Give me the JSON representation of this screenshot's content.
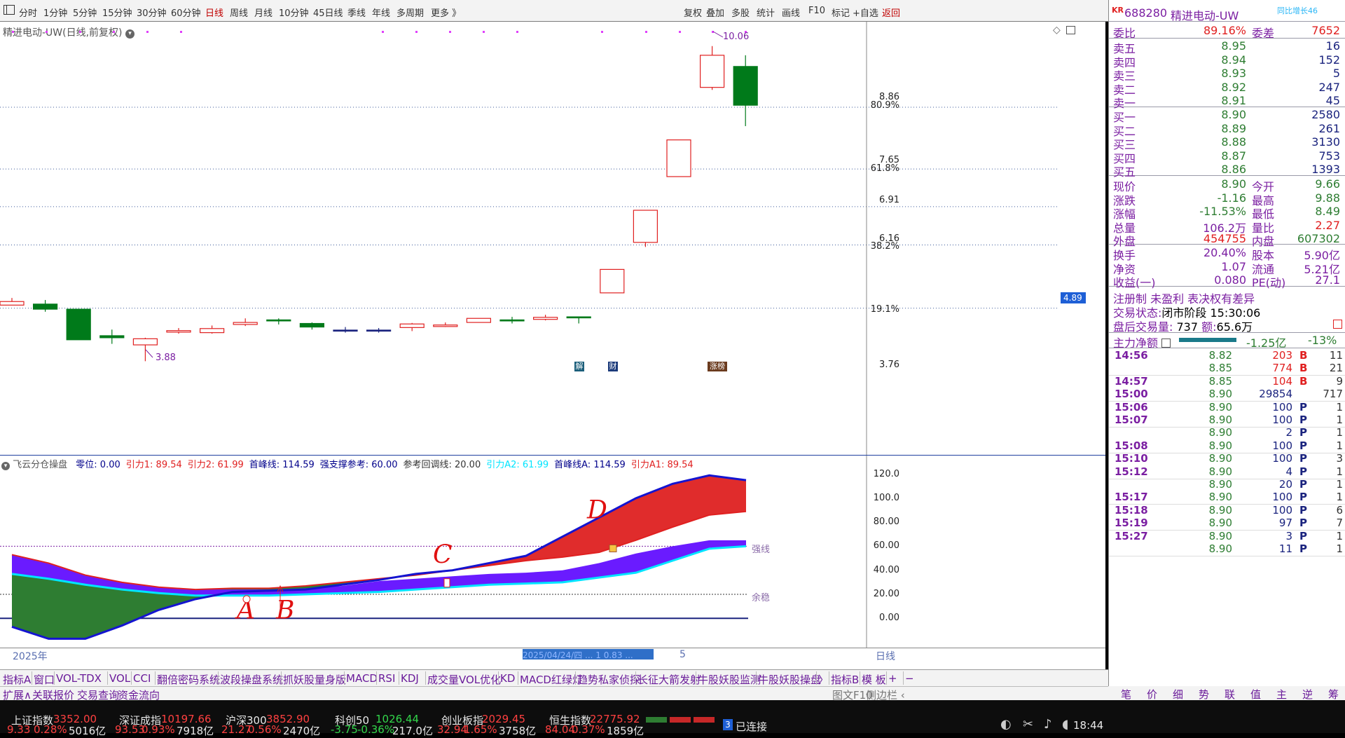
{
  "toolbar": {
    "left_items": [
      "分时",
      "1分钟",
      "5分钟",
      "15分钟",
      "30分钟",
      "60分钟",
      "日线",
      "周线",
      "月线",
      "10分钟",
      "45日线",
      "季线",
      "年线",
      "多周期",
      "更多 》"
    ],
    "active": "日线",
    "right_items": [
      "复权",
      "叠加",
      "多股",
      "统计",
      "画线",
      "F10",
      "标记",
      "+自选",
      "返回"
    ]
  },
  "chart": {
    "title": "精进电动-UW(日线,前复权)",
    "high_label": "10.06",
    "low_label": "3.88",
    "price_ticks": [
      "8.86",
      "7.65",
      "6.91",
      "6.16",
      "3.76"
    ],
    "pct_ticks": [
      "80.9%",
      "61.8%",
      "38.2%",
      "19.1%"
    ],
    "current_marker": "4.89",
    "event_markers": [
      "解",
      "财",
      "涨榜"
    ],
    "candles": [
      {
        "o": 5.05,
        "c": 4.98,
        "h": 5.12,
        "l": 4.98,
        "dir": "up"
      },
      {
        "o": 5.0,
        "c": 4.9,
        "h": 5.08,
        "l": 4.85,
        "dir": "down"
      },
      {
        "o": 4.9,
        "c": 4.3,
        "h": 4.9,
        "l": 4.3,
        "dir": "down"
      },
      {
        "o": 4.38,
        "c": 4.34,
        "h": 4.5,
        "l": 4.22,
        "dir": "down"
      },
      {
        "o": 4.2,
        "c": 4.32,
        "h": 4.34,
        "l": 3.88,
        "dir": "up"
      },
      {
        "o": 4.45,
        "c": 4.48,
        "h": 4.53,
        "l": 4.42,
        "dir": "up"
      },
      {
        "o": 4.44,
        "c": 4.52,
        "h": 4.58,
        "l": 4.42,
        "dir": "up"
      },
      {
        "o": 4.6,
        "c": 4.64,
        "h": 4.72,
        "l": 4.57,
        "dir": "up"
      },
      {
        "o": 4.69,
        "c": 4.67,
        "h": 4.72,
        "l": 4.6,
        "dir": "down"
      },
      {
        "o": 4.62,
        "c": 4.55,
        "h": 4.64,
        "l": 4.5,
        "dir": "down"
      },
      {
        "o": 4.49,
        "c": 4.49,
        "h": 4.55,
        "l": 4.44,
        "dir": "flat"
      },
      {
        "o": 4.49,
        "c": 4.49,
        "h": 4.53,
        "l": 4.44,
        "dir": "flat"
      },
      {
        "o": 4.54,
        "c": 4.61,
        "h": 4.63,
        "l": 4.47,
        "dir": "up"
      },
      {
        "o": 4.56,
        "c": 4.59,
        "h": 4.64,
        "l": 4.55,
        "dir": "up"
      },
      {
        "o": 4.64,
        "c": 4.72,
        "h": 4.72,
        "l": 4.64,
        "dir": "up"
      },
      {
        "o": 4.69,
        "c": 4.67,
        "h": 4.75,
        "l": 4.62,
        "dir": "down"
      },
      {
        "o": 4.7,
        "c": 4.74,
        "h": 4.79,
        "l": 4.68,
        "dir": "up"
      },
      {
        "o": 4.75,
        "c": 4.73,
        "h": 4.75,
        "l": 4.62,
        "dir": "down"
      },
      {
        "o": 5.22,
        "c": 5.68,
        "h": 5.68,
        "l": 5.22,
        "dir": "up"
      },
      {
        "o": 6.21,
        "c": 6.84,
        "h": 6.84,
        "l": 6.12,
        "dir": "up"
      },
      {
        "o": 7.5,
        "c": 8.22,
        "h": 8.22,
        "l": 7.5,
        "dir": "up"
      },
      {
        "o": 9.25,
        "c": 9.88,
        "h": 10.06,
        "l": 9.2,
        "dir": "up"
      },
      {
        "o": 9.66,
        "c": 8.9,
        "h": 9.88,
        "l": 8.49,
        "dir": "down"
      }
    ]
  },
  "indicator": {
    "name": "飞云分仓操盘",
    "params": [
      {
        "t": "零位: 0.00",
        "c": "#00008b"
      },
      {
        "t": "引力1: 89.54",
        "c": "#e02020"
      },
      {
        "t": "引力2: 61.99",
        "c": "#e02020"
      },
      {
        "t": "首峰线: 114.59",
        "c": "#00008b"
      },
      {
        "t": "强支撑参考: 60.00",
        "c": "#00008b"
      },
      {
        "t": "参考回调线: 20.00",
        "c": "#333333"
      },
      {
        "t": "引力A2: 61.99",
        "c": "#00e5ff"
      },
      {
        "t": "首峰线A: 114.59",
        "c": "#00008b"
      },
      {
        "t": "引力A1: 89.54",
        "c": "#e02020"
      }
    ],
    "y_ticks": [
      "120.0",
      "100.0",
      "80.00",
      "60.00",
      "40.00",
      "20.00",
      "0.00"
    ],
    "ref_labels": [
      "强线",
      "余稳"
    ],
    "annotations": [
      "A",
      "B",
      "C",
      "D"
    ],
    "blue_line": [
      -7,
      -17,
      -17,
      -6,
      7,
      16,
      22,
      23,
      24,
      28,
      32,
      37,
      40,
      46,
      52,
      68,
      84,
      100,
      112,
      119,
      115
    ],
    "red_line": [
      53,
      46,
      36,
      30,
      26,
      24,
      25,
      25,
      27,
      30,
      33,
      36,
      40,
      44,
      48,
      51,
      55,
      65,
      76,
      86,
      89
    ],
    "purple_line": [
      53,
      46,
      36,
      30,
      26,
      24,
      24,
      24,
      25,
      27,
      31,
      33,
      35,
      37,
      38,
      40,
      46,
      54,
      60,
      65,
      65
    ],
    "cyan_line": [
      37,
      33,
      28,
      24,
      21,
      19,
      19,
      19,
      20,
      21,
      22,
      24,
      26,
      28,
      29,
      30,
      34,
      38,
      48,
      58,
      60
    ]
  },
  "date_bar": {
    "year": "2025年",
    "highlight": "2025/04/24/四 ... 1 0.83 ...",
    "day": "5",
    "period": "日线"
  },
  "tabs_row1": [
    "指标A",
    "窗口",
    "VOL-TDX",
    "VOL",
    "CCI",
    "翻倍密码系统",
    "波段操盘系统",
    "抓妖股量身版",
    "MACD",
    "RSI",
    "KDJ",
    "成交量VOL优化",
    "KD",
    "MACD红绿灯",
    "趋势私家侦探",
    "长征大箭发射",
    "牛股妖股监测",
    "牛股妖股操盘",
    "〉",
    "指标B",
    "模 板",
    "+",
    "−"
  ],
  "tabs_row2": [
    "扩展∧",
    "关联报价",
    "交易查询",
    "资金流向"
  ],
  "tabs_row2_right": [
    "图文F10",
    "侧边栏 ‹"
  ],
  "right_tabs": [
    "笔",
    "价",
    "细",
    "势",
    "联",
    "值",
    "主",
    "逆",
    "筹"
  ],
  "quote": {
    "market_tag": "KR",
    "code": "688280",
    "name": "精进电动-UW",
    "note": "同比增长46",
    "weibi_label": "委比",
    "weibi": "89.16%",
    "weicha_label": "委差",
    "weicha": "7652",
    "asks": [
      {
        "l": "卖五",
        "p": "8.95",
        "v": "16"
      },
      {
        "l": "卖四",
        "p": "8.94",
        "v": "152"
      },
      {
        "l": "卖三",
        "p": "8.93",
        "v": "5"
      },
      {
        "l": "卖二",
        "p": "8.92",
        "v": "247"
      },
      {
        "l": "卖一",
        "p": "8.91",
        "v": "45"
      }
    ],
    "bids": [
      {
        "l": "买一",
        "p": "8.90",
        "v": "2580"
      },
      {
        "l": "买二",
        "p": "8.89",
        "v": "261"
      },
      {
        "l": "买三",
        "p": "8.88",
        "v": "3130"
      },
      {
        "l": "买四",
        "p": "8.87",
        "v": "753"
      },
      {
        "l": "买五",
        "p": "8.86",
        "v": "1393"
      }
    ],
    "stats1": [
      {
        "l1": "现价",
        "v1": "8.90",
        "l2": "今开",
        "v2": "9.66",
        "c1": "#2e7d32",
        "c2": "#2e7d32"
      },
      {
        "l1": "涨跌",
        "v1": "-1.16",
        "l2": "最高",
        "v2": "9.88",
        "c1": "#2e7d32",
        "c2": "#2e7d32"
      },
      {
        "l1": "涨幅",
        "v1": "-11.53%",
        "l2": "最低",
        "v2": "8.49",
        "c1": "#2e7d32",
        "c2": "#2e7d32"
      },
      {
        "l1": "总量",
        "v1": "106.2万",
        "l2": "量比",
        "v2": "2.27",
        "c1": "#7b1fa2",
        "c2": "#e02020"
      },
      {
        "l1": "外盘",
        "v1": "454755",
        "l2": "内盘",
        "v2": "607302",
        "c1": "#e02020",
        "c2": "#2e7d32"
      }
    ],
    "stats2": [
      {
        "l1": "换手",
        "v1": "20.40%",
        "l2": "股本",
        "v2": "5.90亿"
      },
      {
        "l1": "净资",
        "v1": "1.07",
        "l2": "流通",
        "v2": "5.21亿"
      },
      {
        "l1": "收益(一)",
        "v1": "0.080",
        "l2": "PE(动)",
        "v2": "27.1"
      }
    ],
    "reg_note": "注册制 未盈利 表决权有差异",
    "trade_status_label": "交易状态:",
    "trade_status": "闭市阶段 15:30:06",
    "after_hours_label": "盘后交易量:",
    "after_hours_vol": "737",
    "after_hours_amt_label": "额:",
    "after_hours_amt": "65.6万",
    "main_net_label": "主力净额",
    "main_net": "-1.25亿",
    "main_net_pct": "-13%",
    "trades": [
      {
        "t": "14:56",
        "p": "8.82",
        "v": "203",
        "d": "B",
        "n": "11"
      },
      {
        "t": "",
        "p": "8.85",
        "v": "774",
        "d": "B",
        "n": "21"
      },
      {
        "t": "14:57",
        "p": "8.85",
        "v": "104",
        "d": "B",
        "n": "9"
      },
      {
        "t": "15:00",
        "p": "8.90",
        "v": "29854",
        "d": "",
        "n": "717"
      },
      {
        "t": "15:06",
        "p": "8.90",
        "v": "100",
        "d": "P",
        "n": "1"
      },
      {
        "t": "15:07",
        "p": "8.90",
        "v": "100",
        "d": "P",
        "n": "1"
      },
      {
        "t": "",
        "p": "8.90",
        "v": "2",
        "d": "P",
        "n": "1"
      },
      {
        "t": "15:08",
        "p": "8.90",
        "v": "100",
        "d": "P",
        "n": "1"
      },
      {
        "t": "15:10",
        "p": "8.90",
        "v": "100",
        "d": "P",
        "n": "3"
      },
      {
        "t": "15:12",
        "p": "8.90",
        "v": "4",
        "d": "P",
        "n": "1"
      },
      {
        "t": "",
        "p": "8.90",
        "v": "20",
        "d": "P",
        "n": "1"
      },
      {
        "t": "15:17",
        "p": "8.90",
        "v": "100",
        "d": "P",
        "n": "1"
      },
      {
        "t": "15:18",
        "p": "8.90",
        "v": "100",
        "d": "P",
        "n": "6"
      },
      {
        "t": "15:19",
        "p": "8.90",
        "v": "97",
        "d": "P",
        "n": "7"
      },
      {
        "t": "15:27",
        "p": "8.90",
        "v": "3",
        "d": "P",
        "n": "1"
      },
      {
        "t": "",
        "p": "8.90",
        "v": "11",
        "d": "P",
        "n": "1"
      }
    ]
  },
  "status_bar": {
    "indices": [
      {
        "name": "上证指数",
        "val": "3352.00",
        "chg": "9.33",
        "pct": "0.28%",
        "amt": "5016亿",
        "c": "#ff4040"
      },
      {
        "name": "深证成指",
        "val": "10197.66",
        "chg": "93.53",
        "pct": "0.93%",
        "amt": "7918亿",
        "c": "#ff4040"
      },
      {
        "name": "沪深300",
        "val": "3852.90",
        "chg": "21.27",
        "pct": "0.56%",
        "amt": "2470亿",
        "c": "#ff4040"
      },
      {
        "name": "科创50",
        "val": "1026.44",
        "chg": "-3.75",
        "pct": "-0.36%",
        "amt": "217.0亿",
        "c": "#32d74b"
      },
      {
        "name": "创业板指",
        "val": "2029.45",
        "chg": "32.94",
        "pct": "1.65%",
        "amt": "3758亿",
        "c": "#ff4040"
      },
      {
        "name": "恒生指数",
        "val": "22775.92",
        "chg": "84.04",
        "pct": "0.37%",
        "amt": "1859亿",
        "c": "#ff4040"
      }
    ],
    "conn_count": "3",
    "conn_label": "已连接",
    "time": "18:44"
  }
}
